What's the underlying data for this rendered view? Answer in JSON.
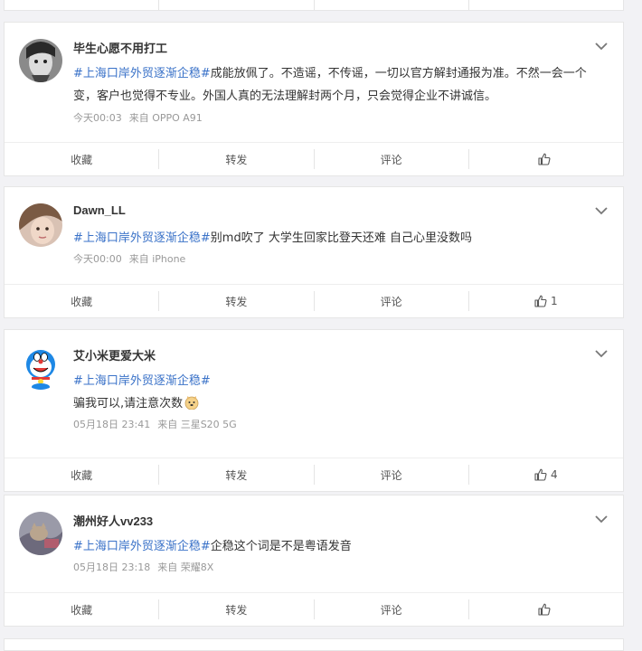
{
  "toolbar": {
    "favorite": "收藏",
    "repost": "转发",
    "comment": "评论"
  },
  "posts": [
    {
      "username": "毕生心愿不用打工",
      "hashtag": "#上海口岸外贸逐渐企稳#",
      "text": "成能放佩了。不造谣，不传谣，一切以官方解封通报为准。不然一会一个变，客户也觉得不专业。外国人真的无法理解封两个月，只会觉得企业不讲诚信。",
      "time": "今天00:03",
      "source": "来自 OPPO A91",
      "likes": ""
    },
    {
      "username": "Dawn_LL",
      "hashtag": "#上海口岸外贸逐渐企稳#",
      "text": "别md吹了 大学生回家比登天还难 自己心里没数吗",
      "time": "今天00:00",
      "source": "来自 iPhone",
      "likes": "1"
    },
    {
      "username": "艾小米更爱大米",
      "hashtag": "#上海口岸外贸逐渐企稳#",
      "text": "骗我可以,请注意次数",
      "time": "05月18日 23:41",
      "source": "来自 三星S20 5G",
      "likes": "4",
      "emoji": "doge-emoji"
    },
    {
      "username": "潮州好人vv233",
      "hashtag": "#上海口岸外贸逐渐企稳#",
      "text": "企稳这个词是不是粤语发音",
      "time": "05月18日 23:18",
      "source": "来自 荣耀8X",
      "likes": ""
    }
  ],
  "colors": {
    "hashtag": "#3a72c8",
    "background": "#f2f2f5"
  },
  "icons": {
    "more": "chevron-down-icon",
    "like": "thumbs-up-icon"
  }
}
